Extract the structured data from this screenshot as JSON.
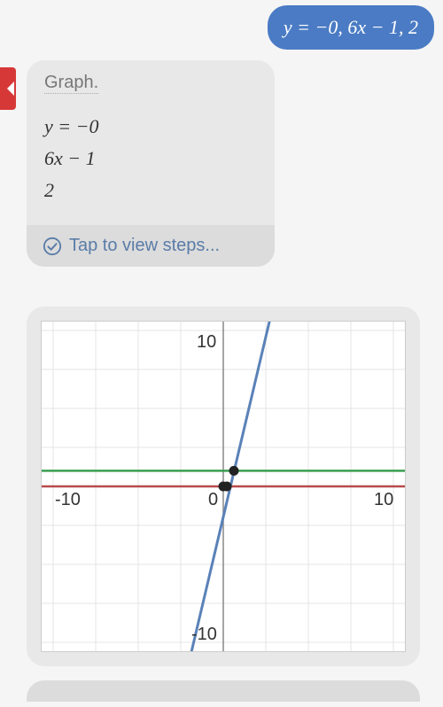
{
  "user_message": {
    "equation": "y = −0, 6x − 1, 2"
  },
  "answer_card": {
    "header": "Graph.",
    "lines": [
      "y = −0",
      "6x − 1",
      "2"
    ],
    "steps_cta": "Tap to view steps..."
  },
  "chart_data": {
    "type": "line",
    "title": "",
    "xlabel": "",
    "ylabel": "",
    "xlim": [
      -10,
      10
    ],
    "ylim": [
      -10,
      10
    ],
    "x_ticks": [
      -10,
      0,
      10
    ],
    "y_ticks": [
      -10,
      10
    ],
    "grid": true,
    "series": [
      {
        "name": "y = -0",
        "color": "#b94a4a",
        "type": "horizontal",
        "y": 0
      },
      {
        "name": "y = 6x - 1",
        "color": "#5a82b8",
        "type": "linear",
        "slope": 6,
        "intercept": -1
      },
      {
        "name": "y = 2",
        "color": "#3a9e4f",
        "type": "horizontal",
        "y": 2
      }
    ],
    "points": [
      {
        "x": 0,
        "y": 0
      },
      {
        "x": 0.1667,
        "y": 0
      },
      {
        "x": 0.5,
        "y": 2
      }
    ],
    "tick_labels": {
      "x_neg": "-10",
      "x_pos": "10",
      "y_neg": "-10",
      "y_pos": "10",
      "origin": "0"
    }
  }
}
